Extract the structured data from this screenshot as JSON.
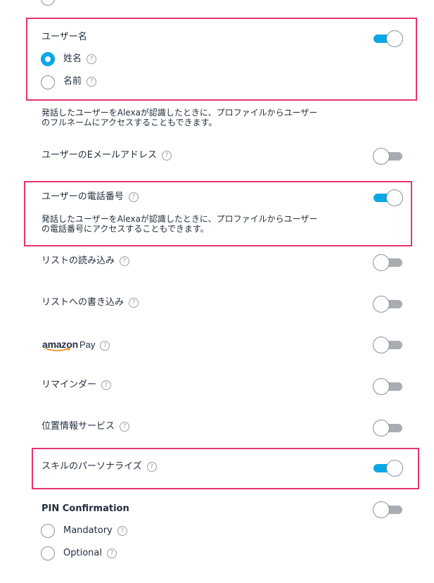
{
  "help_glyph": "?",
  "username": {
    "label": "ユーザー名",
    "toggle_on": true,
    "options": [
      {
        "label": "姓名",
        "selected": true
      },
      {
        "label": "名前",
        "selected": false
      }
    ],
    "description_line1": "発話したユーザーをAlexaが認識したときに、プロファイルからユーザー",
    "description_line2": "のフルネームにアクセスすることもできます。"
  },
  "email": {
    "label": "ユーザーのEメールアドレス",
    "toggle_on": false
  },
  "phone": {
    "label": "ユーザーの電話番号",
    "toggle_on": true,
    "description_line1": "発話したユーザーをAlexaが認識したときに、プロファイルからユーザー",
    "description_line2": "の電話番号にアクセスすることもできます。"
  },
  "list_read": {
    "label": "リストの読み込み",
    "toggle_on": false
  },
  "list_write": {
    "label": "リストへの書き込み",
    "toggle_on": false
  },
  "amazon_pay": {
    "logo": "amazon",
    "label": "Pay",
    "toggle_on": false
  },
  "reminders": {
    "label": "リマインダー",
    "toggle_on": false
  },
  "location": {
    "label": "位置情報サービス",
    "toggle_on": false
  },
  "personalization": {
    "label": "スキルのパーソナライズ",
    "toggle_on": true
  },
  "pin": {
    "label": "PIN Confirmation",
    "toggle_on": false,
    "options": [
      {
        "label": "Mandatory",
        "selected": false
      },
      {
        "label": "Optional",
        "selected": false
      }
    ]
  },
  "colors": {
    "accent": "#0aa7e6",
    "highlight": "#e8336f",
    "toggle_off": "#a9adb3"
  }
}
